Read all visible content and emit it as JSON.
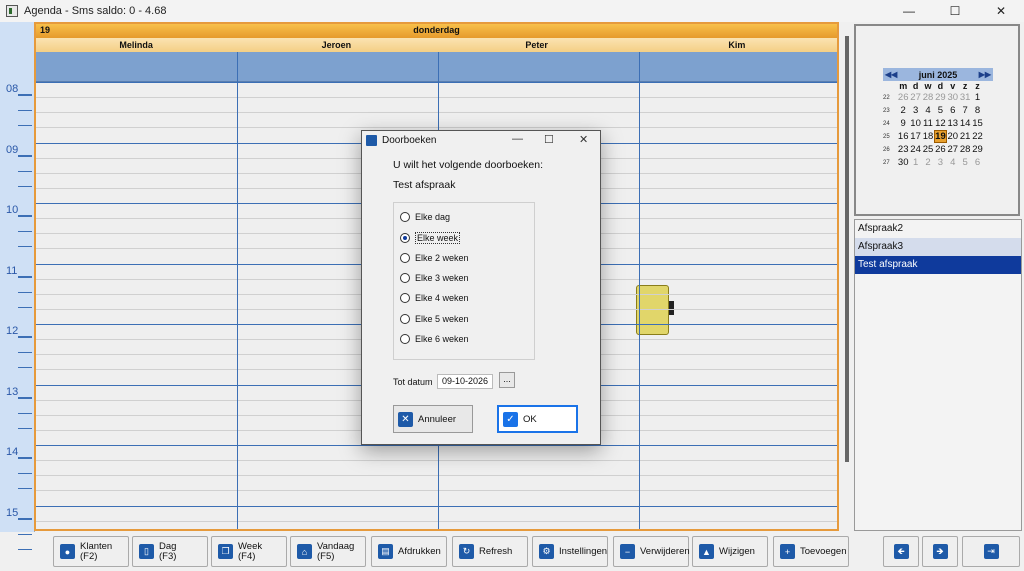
{
  "window": {
    "title": "Agenda - Sms saldo: 0 - 4.68",
    "minimize": "—",
    "maximize": "☐",
    "close": "✕"
  },
  "agenda": {
    "day_number": "19",
    "day_name": "donderdag",
    "columns": [
      "Melinda",
      "Jeroen",
      "Peter",
      "Kim"
    ],
    "hours": [
      "08",
      "09",
      "10",
      "11",
      "12",
      "13",
      "14",
      "15"
    ],
    "appointment_color": "#e1d66a"
  },
  "calendar": {
    "month_label": "juni 2025",
    "weekdays": [
      "m",
      "d",
      "w",
      "d",
      "v",
      "z",
      "z"
    ],
    "weeks": [
      {
        "wn": "22",
        "days": [
          "26",
          "27",
          "28",
          "29",
          "30",
          "31",
          "1"
        ]
      },
      {
        "wn": "23",
        "days": [
          "2",
          "3",
          "4",
          "5",
          "6",
          "7",
          "8"
        ]
      },
      {
        "wn": "24",
        "days": [
          "9",
          "10",
          "11",
          "12",
          "13",
          "14",
          "15"
        ]
      },
      {
        "wn": "25",
        "days": [
          "16",
          "17",
          "18",
          "19",
          "20",
          "21",
          "22"
        ]
      },
      {
        "wn": "26",
        "days": [
          "23",
          "24",
          "25",
          "26",
          "27",
          "28",
          "29"
        ]
      },
      {
        "wn": "27",
        "days": [
          "30",
          "1",
          "2",
          "3",
          "4",
          "5",
          "6"
        ]
      }
    ],
    "today": "19"
  },
  "appointments_list": [
    "Afspraak2",
    "Afspraak3",
    "Test afspraak"
  ],
  "toolbar": [
    {
      "label": "Klanten",
      "sub": "(F2)",
      "icon": "user-icon"
    },
    {
      "label": "Dag",
      "sub": "(F3)",
      "icon": "page-icon"
    },
    {
      "label": "Week",
      "sub": "(F4)",
      "icon": "copy-icon"
    },
    {
      "label": "Vandaag",
      "sub": "(F5)",
      "icon": "home-icon"
    },
    {
      "label": "Afdrukken",
      "sub": "",
      "icon": "printer-icon"
    },
    {
      "label": "Refresh",
      "sub": "",
      "icon": "refresh-icon"
    },
    {
      "label": "Instellingen",
      "sub": "",
      "icon": "settings-icon"
    },
    {
      "label": "Verwijderen",
      "sub": "",
      "icon": "minus-icon"
    },
    {
      "label": "Wijzigen",
      "sub": "",
      "icon": "triangle-icon"
    },
    {
      "label": "Toevoegen",
      "sub": "",
      "icon": "plus-icon"
    }
  ],
  "nav": {
    "prev": "🡸",
    "next": "🡺",
    "exit": "⇥"
  },
  "dialog": {
    "title": "Doorboeken",
    "question": "U wilt het volgende doorboeken:",
    "appointment": "Test afspraak",
    "options": [
      "Elke dag",
      "Elke week",
      "Elke 2 weken",
      "Elke 3 weken",
      "Elke 4 weken",
      "Elke 5 weken",
      "Elke 6 weken"
    ],
    "selected_option": "Elke week",
    "until_label": "Tot datum",
    "until_value": "09-10-2026",
    "browse": "...",
    "cancel_label": "Annuleer",
    "ok_label": "OK"
  }
}
